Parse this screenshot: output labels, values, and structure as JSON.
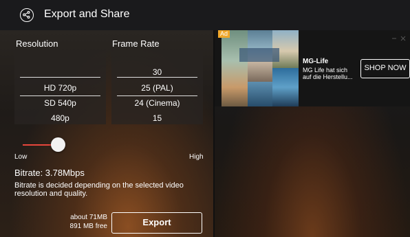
{
  "header": {
    "title": "Export and Share",
    "back_icon": "share-circle-icon"
  },
  "resolution": {
    "label": "Resolution",
    "options": [
      "",
      "HD 720p",
      "SD 540p",
      "480p"
    ],
    "selected": "HD 720p"
  },
  "frame_rate": {
    "label": "Frame Rate",
    "options": [
      "30",
      "25 (PAL)",
      "24 (Cinema)",
      "15"
    ],
    "selected": "25 (PAL)"
  },
  "quality_slider": {
    "low_label": "Low",
    "high_label": "High",
    "level": 0.2,
    "accent_color": "#e8463c"
  },
  "bitrate": {
    "value_text": "Bitrate: 3.78Mbps",
    "note": "Bitrate is decided depending on the selected video resolution and quality."
  },
  "export": {
    "size_estimate": "about 71MB",
    "free_space": "891 MB free",
    "button_label": "Export"
  },
  "ad": {
    "badge": "Ad",
    "badge_color": "#f1a72a",
    "advertiser": "MG-Life",
    "description": "MG Life hat sich auf die Herstellu...",
    "cta": "SHOP NOW"
  }
}
